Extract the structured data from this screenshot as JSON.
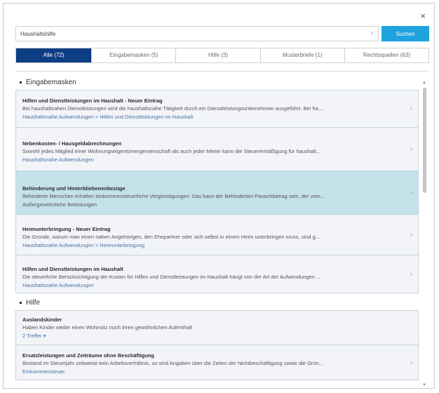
{
  "dialog": {
    "close_label": "×"
  },
  "search": {
    "value": "Haushaltshilfe",
    "clear_label": "×",
    "button_label": "Suchen"
  },
  "tabs": [
    {
      "label": "Alle (72)"
    },
    {
      "label": "Eingabemasken (5)"
    },
    {
      "label": "Hilfe (3)"
    },
    {
      "label": "Musterbriefe (1)"
    },
    {
      "label": "Rechtsquellen (63)"
    }
  ],
  "sections": {
    "eingabemasken": {
      "title": "Eingabemasken"
    },
    "hilfe": {
      "title": "Hilfe"
    }
  },
  "eingabemasken_items": [
    {
      "title": "Hilfen und Dienstleistungen im Haushalt - Neuer Eintrag",
      "desc": "Bei haushaltnahen Dienstleistungen wird die haushaltsnahe Tätigkeit durch ein Dienstleistungsunternehmen ausgeführt. Bei ha...",
      "breadcrumb": "Haushaltsnahe Aufwendungen > Hilfen und Dienstleistungen im Haushalt"
    },
    {
      "title": "Nebenkosten- / Hausgeldabrechnungen",
      "desc": "Sowohl jedes Mitglied einer Wohnungseigentümergemeinschaft als auch jeder Mieter kann die Steuerermäßigung für haushalt...",
      "breadcrumb": "Haushaltsnahe Aufwendungen"
    },
    {
      "title": "Behinderung und Hinterbliebenenbezüge",
      "desc": "Behinderte Menschen erhalten einkommensteuerliche Vergünstigungen. Das kann der Behinderten-Pauschbetrag sein, der vom...",
      "breadcrumb": "Außergewöhnliche Belastungen"
    },
    {
      "title": "Heimunterbringung - Neuer Eintrag",
      "desc": "Die Gründe, warum man einen nahen Angehörigen, den Ehepartner oder sich selbst in einem Heim unterbringen muss, sind g...",
      "breadcrumb": "Haushaltsnahe Aufwendungen > Heimunterbringung"
    },
    {
      "title": "Hilfen und Dienstleistungen im Haushalt",
      "desc": "Die steuerliche Berücksichtigung der Kosten für Hilfen und Dienstleistungen im Haushalt hängt von der Art der Aufwendungen ...",
      "breadcrumb": "Haushaltsnahe Aufwendungen"
    }
  ],
  "hilfe_items": [
    {
      "title": "Auslandskinder",
      "desc": "Haben Kinder weder einen Wohnsitz noch ihren gewöhnlichen Aufenthalt",
      "breadcrumb": "2 Treffer ▾"
    },
    {
      "title": "Ersatzleistungen und Zeiträume ohne Beschäftigung",
      "desc": "Bestand im Steuerjahr zeitweise kein Arbeitsverhältnis, so sind Angaben über die Zeiten der Nichtbeschäftigung sowie die Grün...",
      "breadcrumb": "Einkommensteuer"
    }
  ],
  "icons": {
    "chevron": "chevron-right-icon",
    "close": "close-icon",
    "clear": "clear-icon"
  },
  "colors": {
    "primary": "#0d3d82",
    "search_button": "#1ea3de",
    "highlight": "#c5e1ea",
    "link": "#4a72a8",
    "card_bg": "#f2f4f8"
  }
}
